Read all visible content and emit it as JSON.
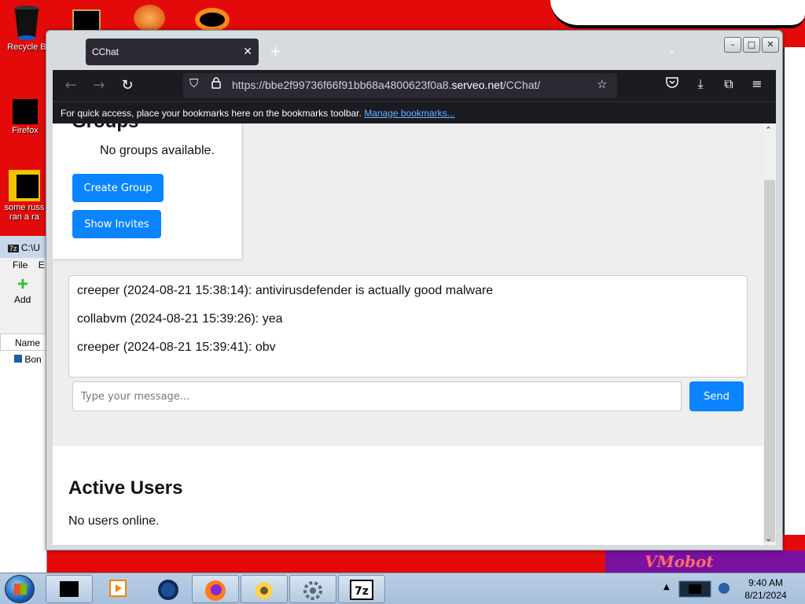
{
  "desktop": {
    "icons": [
      {
        "label": "Recycle B",
        "name": "recycle-bin"
      },
      {
        "label": "Firefox",
        "name": "firefox"
      },
      {
        "label": "some russ ran a ra",
        "name": "shortcut"
      }
    ],
    "wallpaper_text": "VMobot"
  },
  "bg_window": {
    "title": "C:\\U",
    "menu_file": "File",
    "menu_edit": "E",
    "add_label": "Add",
    "name_col": "Name",
    "file_item": "Bon"
  },
  "browser": {
    "tab_title": "CChat",
    "url_prefix": "https://bbe2f99736f66f91bb68a4800623f0a8.",
    "url_domain": "serveo.net",
    "url_path": "/CChat/",
    "bookmarks_text": "For quick access, place your bookmarks here on the bookmarks toolbar.",
    "bookmarks_link": "Manage bookmarks..."
  },
  "page": {
    "groups_heading": "Groups",
    "no_groups": "No groups available.",
    "create_group": "Create Group",
    "show_invites": "Show Invites",
    "messages": [
      "creeper (2024-08-21 15:38:14): antivirusdefender is actually good malware",
      "collabvm (2024-08-21 15:39:26): yea",
      "creeper (2024-08-21 15:39:41): obv"
    ],
    "message_placeholder": "Type your message...",
    "send": "Send",
    "active_users_title": "Active Users",
    "no_users": "No users online."
  },
  "taskbar": {
    "time": "9:40 AM",
    "date": "8/21/2024"
  }
}
